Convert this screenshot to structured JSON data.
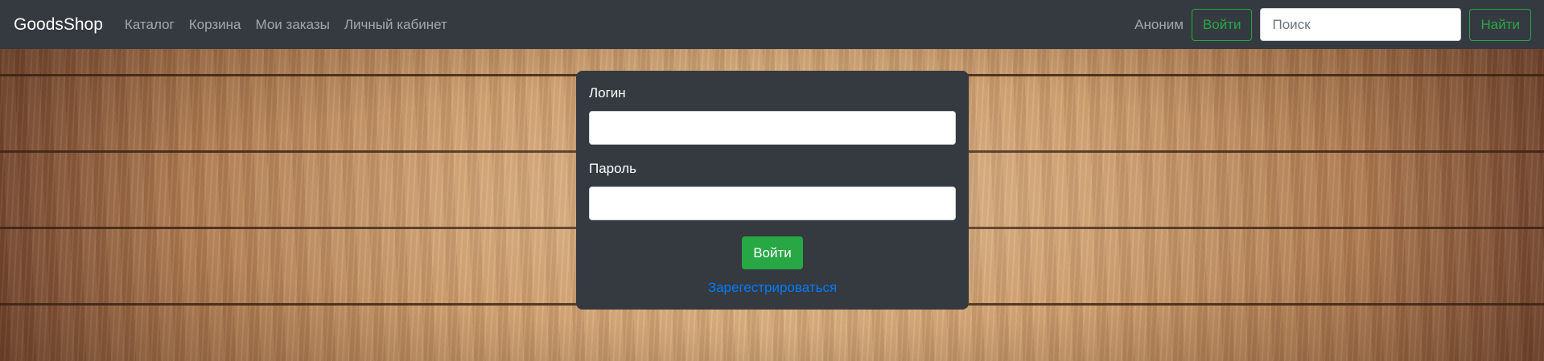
{
  "header": {
    "brand": "GoodsShop",
    "nav": [
      {
        "label": "Каталог"
      },
      {
        "label": "Корзина"
      },
      {
        "label": "Мои заказы"
      },
      {
        "label": "Личный кабинет"
      }
    ],
    "user_name": "Аноним",
    "login_button": "Войти",
    "search_placeholder": "Поиск",
    "search_button": "Найти"
  },
  "login_form": {
    "login_label": "Логин",
    "login_value": "",
    "password_label": "Пароль",
    "password_value": "",
    "submit_label": "Войти",
    "register_link": "Зарегестрироваться"
  },
  "colors": {
    "navbar_bg": "#343a40",
    "accent_green": "#28a745",
    "link_blue": "#007bff"
  }
}
